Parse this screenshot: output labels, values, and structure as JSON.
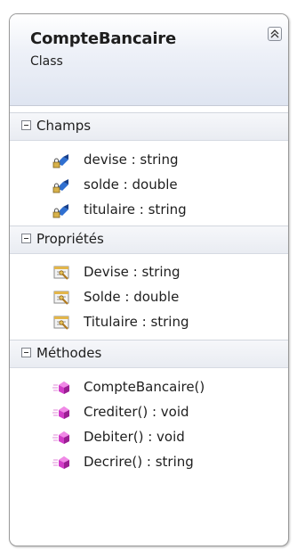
{
  "class": {
    "name": "CompteBancaire",
    "kind": "Class"
  },
  "sections": {
    "fields": {
      "label": "Champs",
      "items": [
        "devise : string",
        "solde : double",
        "titulaire : string"
      ]
    },
    "properties": {
      "label": "Propriétés",
      "items": [
        "Devise : string",
        "Solde : double",
        "Titulaire : string"
      ]
    },
    "methods": {
      "label": "Méthodes",
      "items": [
        "CompteBancaire()",
        "Crediter() : void",
        "Debiter() : void",
        "Decrire() : string"
      ]
    }
  },
  "icons": {
    "collapse": "double-chevron-up-icon",
    "section_toggle": "minus-box-icon",
    "field": "private-field-icon",
    "property": "property-icon",
    "method": "method-icon"
  },
  "colors": {
    "header_gradient_end": "#dfe5f1",
    "field_icon": "#1f5fbf",
    "method_icon": "#d23cc8",
    "property_icon": "#e8c25a"
  }
}
